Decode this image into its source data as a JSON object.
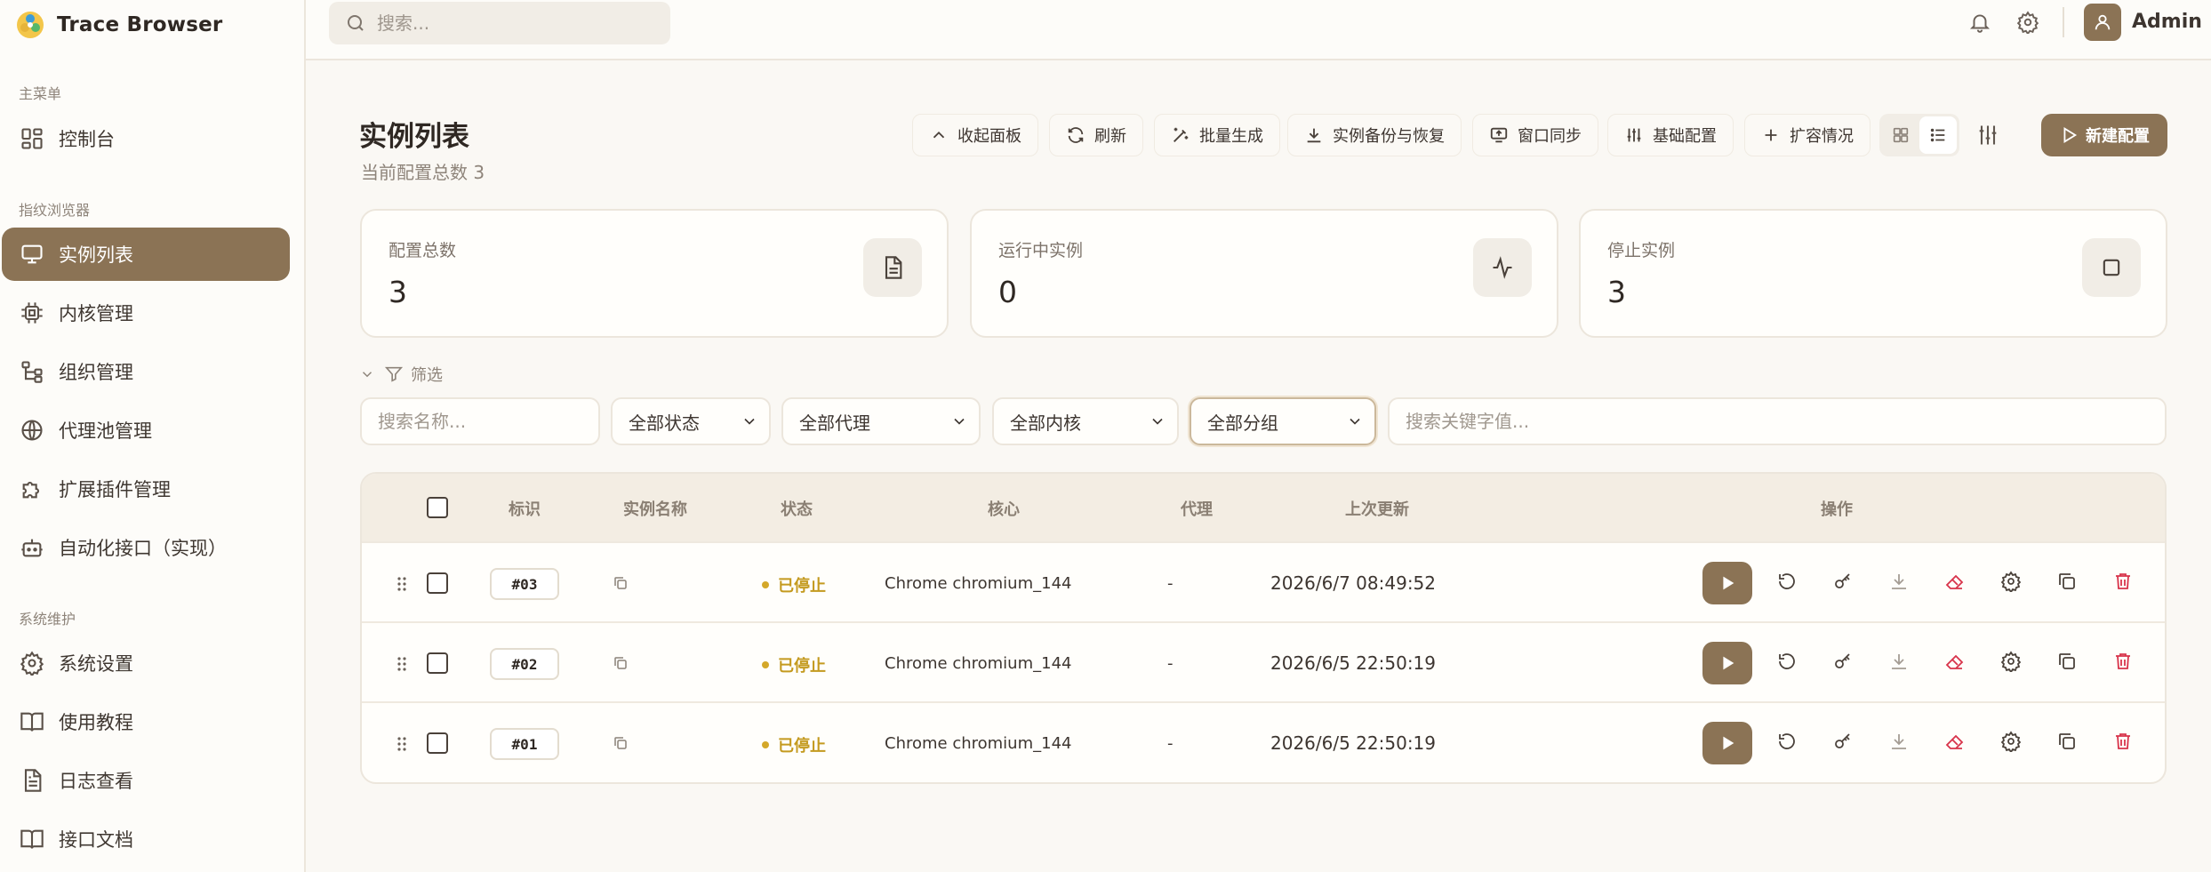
{
  "app": {
    "name": "Trace Browser"
  },
  "search": {
    "placeholder": "搜索..."
  },
  "user": {
    "name": "Admin"
  },
  "sidebar": {
    "sections": [
      {
        "title": "主菜单",
        "items": [
          {
            "label": "控制台",
            "icon": "dashboard-icon"
          }
        ]
      },
      {
        "title": "指纹浏览器",
        "items": [
          {
            "label": "实例列表",
            "icon": "monitor-icon",
            "active": true
          },
          {
            "label": "内核管理",
            "icon": "chip-icon"
          },
          {
            "label": "组织管理",
            "icon": "org-tree-icon"
          },
          {
            "label": "代理池管理",
            "icon": "globe-icon"
          },
          {
            "label": "扩展插件管理",
            "icon": "puzzle-icon"
          },
          {
            "label": "自动化接口（实现）",
            "icon": "bot-icon"
          }
        ]
      },
      {
        "title": "系统维护",
        "items": [
          {
            "label": "系统设置",
            "icon": "gear-icon"
          },
          {
            "label": "使用教程",
            "icon": "book-icon"
          },
          {
            "label": "日志查看",
            "icon": "file-text-icon"
          },
          {
            "label": "接口文档",
            "icon": "book-icon"
          }
        ]
      }
    ]
  },
  "page": {
    "title": "实例列表",
    "subtitle": "当前配置总数 3"
  },
  "toolbar": {
    "buttons": [
      {
        "label": "收起面板",
        "icon": "chevron-up-icon"
      },
      {
        "label": "刷新",
        "icon": "refresh-icon"
      },
      {
        "label": "批量生成",
        "icon": "magic-wand-icon"
      },
      {
        "label": "实例备份与恢复",
        "icon": "download-icon"
      },
      {
        "label": "窗口同步",
        "icon": "screen-share-icon"
      },
      {
        "label": "基础配置",
        "icon": "sliders-icon"
      },
      {
        "label": "扩容情况",
        "icon": "plus-icon"
      }
    ],
    "new_label": "新建配置"
  },
  "stats": [
    {
      "label": "配置总数",
      "value": "3",
      "icon": "document-icon"
    },
    {
      "label": "运行中实例",
      "value": "0",
      "icon": "activity-icon"
    },
    {
      "label": "停止实例",
      "value": "3",
      "icon": "square-icon"
    }
  ],
  "filter": {
    "label": "筛选",
    "name_placeholder": "搜索名称...",
    "status": "全部状态",
    "proxy": "全部代理",
    "core": "全部内核",
    "group": "全部分组",
    "keyword_placeholder": "搜索关键字值..."
  },
  "table": {
    "headers": {
      "id": "标识",
      "name": "实例名称",
      "status": "状态",
      "core": "核心",
      "proxy": "代理",
      "updated": "上次更新",
      "actions": "操作"
    },
    "rows": [
      {
        "id": "#03",
        "status": "已停止",
        "core": "Chrome chromium_144",
        "proxy": "-",
        "updated": "2026/6/7 08:49:52"
      },
      {
        "id": "#02",
        "status": "已停止",
        "core": "Chrome chromium_144",
        "proxy": "-",
        "updated": "2026/6/5 22:50:19"
      },
      {
        "id": "#01",
        "status": "已停止",
        "core": "Chrome chromium_144",
        "proxy": "-",
        "updated": "2026/6/5 22:50:19"
      }
    ]
  },
  "colors": {
    "accent": "#8b7355",
    "status_stopped": "#c49a1f",
    "danger": "#d8334a"
  }
}
